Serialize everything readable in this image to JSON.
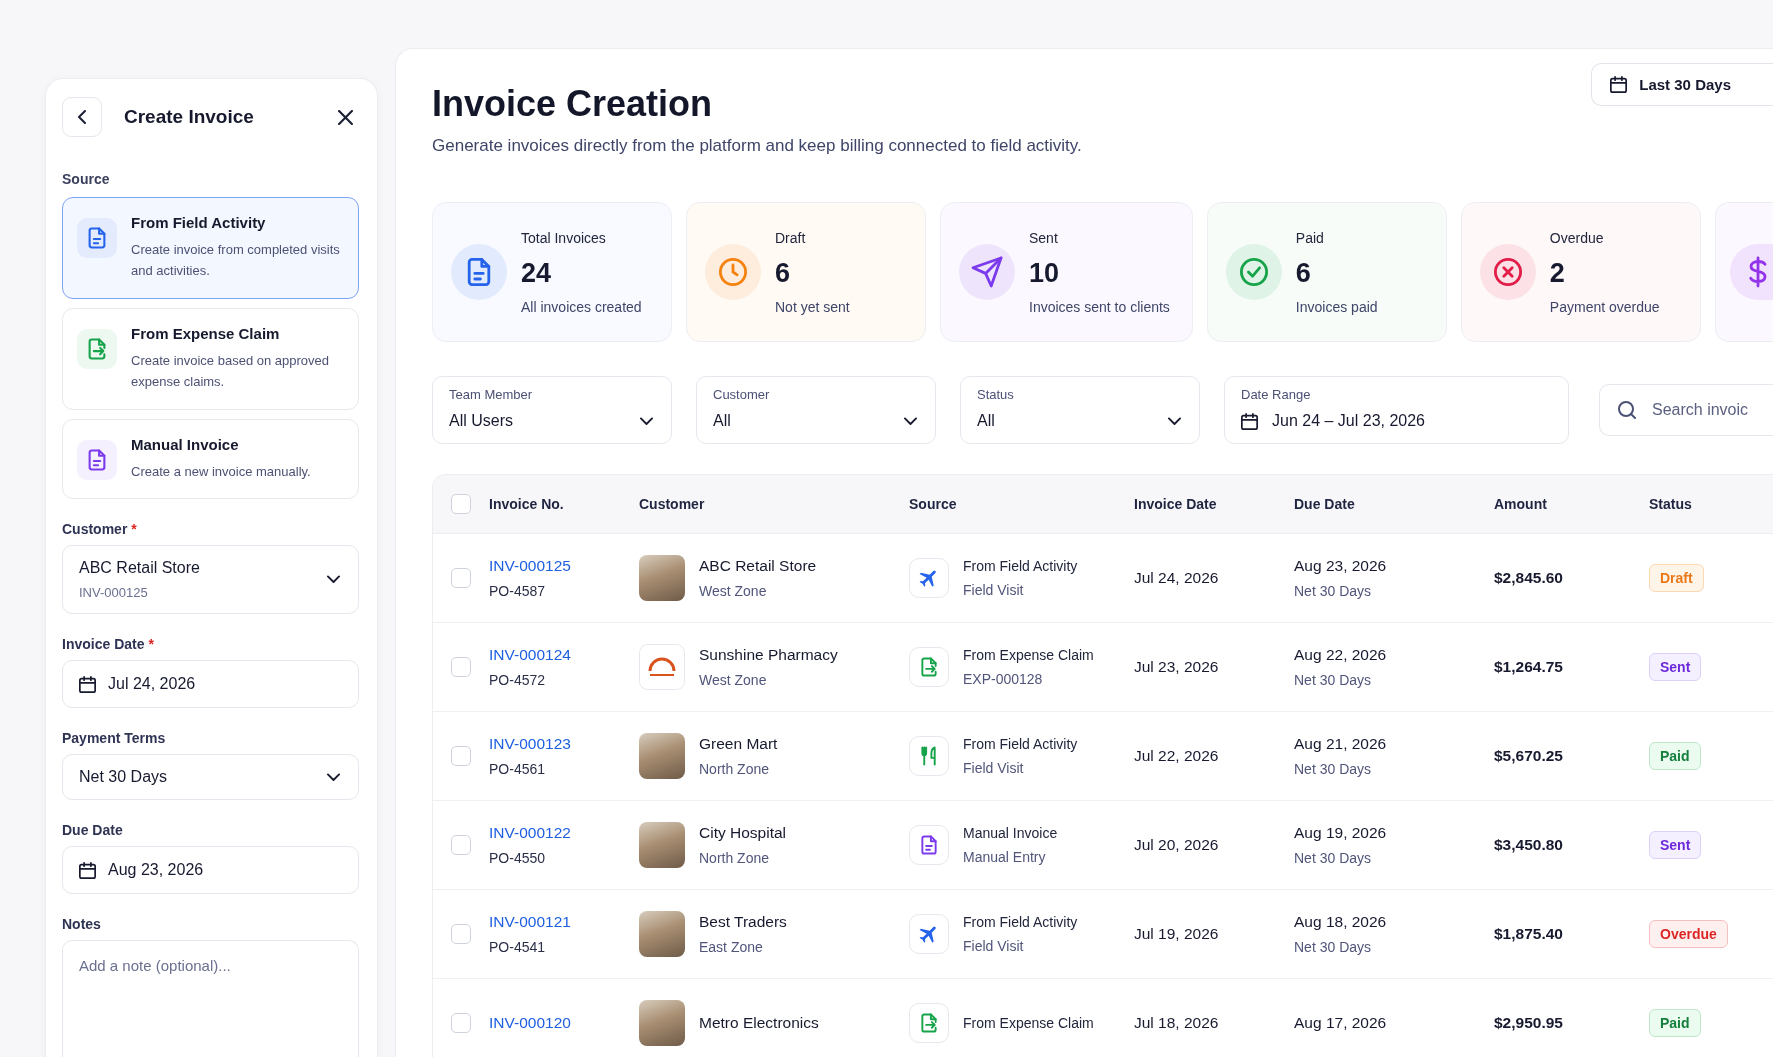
{
  "create_panel": {
    "title": "Create Invoice",
    "source_label": "Source",
    "sources": [
      {
        "kind": "field",
        "title": "From Field Activity",
        "description": "Create invoice from completed visits and activities.",
        "selected": true
      },
      {
        "kind": "expense",
        "title": "From Expense Claim",
        "description": "Create invoice based on approved expense claims.",
        "selected": false
      },
      {
        "kind": "manual",
        "title": "Manual Invoice",
        "description": "Create a new invoice manually.",
        "selected": false
      }
    ],
    "fields": [
      {
        "kind": "select",
        "label": "Customer",
        "required_mark": "*",
        "value": "ABC Retail Store",
        "detail": "INV-000125"
      },
      {
        "kind": "date",
        "label": "Invoice Date",
        "required_mark": "*",
        "value": "Jul 24, 2026"
      },
      {
        "kind": "select",
        "label": "Payment Terms",
        "value": "Net 30 Days"
      },
      {
        "kind": "date",
        "label": "Due Date",
        "value": "Aug 23, 2026"
      },
      {
        "kind": "notes",
        "label": "Notes",
        "placeholder": "Add a note (optional)..."
      }
    ]
  },
  "header": {
    "title": "Invoice Creation",
    "subtitle": "Generate invoices directly from the platform and keep billing connected to field activity.",
    "period_button": "Last 30 Days"
  },
  "stats": [
    {
      "kind": "total",
      "label": "Total Invoices",
      "value": "24",
      "note": "All invoices created"
    },
    {
      "kind": "draft",
      "label": "Draft",
      "value": "6",
      "note": "Not yet sent"
    },
    {
      "kind": "sent",
      "label": "Sent",
      "value": "10",
      "note": "Invoices sent to clients"
    },
    {
      "kind": "paid",
      "label": "Paid",
      "value": "6",
      "note": "Invoices paid"
    },
    {
      "kind": "overdue",
      "label": "Overdue",
      "value": "2",
      "note": "Payment overdue"
    },
    {
      "kind": "currency"
    }
  ],
  "filters": [
    {
      "kind": "select",
      "label": "Team Member",
      "value": "All Users"
    },
    {
      "kind": "select",
      "label": "Customer",
      "value": "All"
    },
    {
      "kind": "select",
      "label": "Status",
      "value": "All"
    },
    {
      "kind": "date",
      "label": "Date Range",
      "value": "Jun 24 – Jul 23, 2026"
    },
    {
      "kind": "search",
      "placeholder": "Search invoic"
    }
  ],
  "table": {
    "select_all": {
      "checked": false
    },
    "columns": [
      "Invoice No.",
      "Customer",
      "Source",
      "Invoice Date",
      "Due Date",
      "Amount",
      "Status"
    ],
    "rows": [
      {
        "checked": false,
        "invoice_no": "INV-000125",
        "po": "PO-4587",
        "customer": {
          "kind": "photo",
          "name": "ABC Retail Store",
          "zone": "West Zone"
        },
        "source": {
          "kind": "visit",
          "title": "From Field Activity",
          "detail": "Field Visit"
        },
        "invoice_date": "Jul 24, 2026",
        "due_date": "Aug 23, 2026",
        "terms": "Net 30 Days",
        "amount": "$2,845.60",
        "status": {
          "kind": "draft",
          "label": "Draft"
        }
      },
      {
        "checked": false,
        "invoice_no": "INV-000124",
        "po": "PO-4572",
        "customer": {
          "kind": "logo",
          "name": "Sunshine Pharmacy",
          "zone": "West Zone"
        },
        "source": {
          "kind": "expense",
          "title": "From Expense Claim",
          "detail": "EXP-000128"
        },
        "invoice_date": "Jul 23, 2026",
        "due_date": "Aug 22, 2026",
        "terms": "Net 30 Days",
        "amount": "$1,264.75",
        "status": {
          "kind": "sent",
          "label": "Sent"
        }
      },
      {
        "checked": false,
        "invoice_no": "INV-000123",
        "po": "PO-4561",
        "customer": {
          "kind": "photo",
          "name": "Green Mart",
          "zone": "North Zone"
        },
        "source": {
          "kind": "meal",
          "title": "From Field Activity",
          "detail": "Field Visit"
        },
        "invoice_date": "Jul 22, 2026",
        "due_date": "Aug 21, 2026",
        "terms": "Net 30 Days",
        "amount": "$5,670.25",
        "status": {
          "kind": "paid",
          "label": "Paid"
        }
      },
      {
        "checked": false,
        "invoice_no": "INV-000122",
        "po": "PO-4550",
        "customer": {
          "kind": "photo",
          "name": "City Hospital",
          "zone": "North Zone"
        },
        "source": {
          "kind": "manual",
          "title": "Manual Invoice",
          "detail": "Manual Entry"
        },
        "invoice_date": "Jul 20, 2026",
        "due_date": "Aug 19, 2026",
        "terms": "Net 30 Days",
        "amount": "$3,450.80",
        "status": {
          "kind": "sent",
          "label": "Sent"
        }
      },
      {
        "checked": false,
        "invoice_no": "INV-000121",
        "po": "PO-4541",
        "customer": {
          "kind": "photo",
          "name": "Best Traders",
          "zone": "East Zone"
        },
        "source": {
          "kind": "visit",
          "title": "From Field Activity",
          "detail": "Field Visit"
        },
        "invoice_date": "Jul 19, 2026",
        "due_date": "Aug 18, 2026",
        "terms": "Net 30 Days",
        "amount": "$1,875.40",
        "status": {
          "kind": "overdue",
          "label": "Overdue"
        }
      },
      {
        "checked": false,
        "invoice_no": "INV-000120",
        "customer": {
          "kind": "photo",
          "name": "Metro Electronics"
        },
        "source": {
          "kind": "expense",
          "title": "From Expense Claim"
        },
        "invoice_date": "Jul 18, 2026",
        "due_date": "Aug 17, 2026",
        "amount": "$2,950.95",
        "status": {
          "kind": "paid",
          "label": "Paid"
        }
      }
    ]
  }
}
